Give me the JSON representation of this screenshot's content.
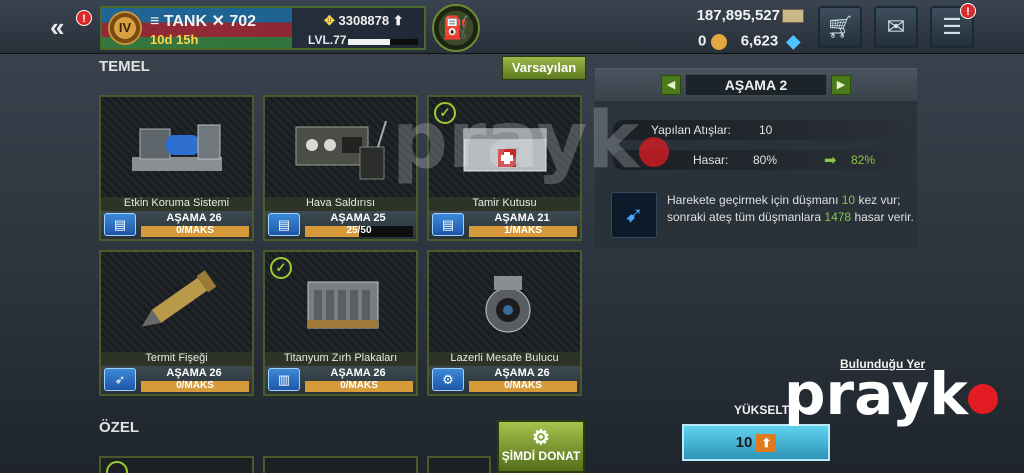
{
  "topbar": {
    "back_icon": "double-chevron-left",
    "back_badge": "!",
    "player": {
      "rank": "IV",
      "name": "TANK",
      "tank_number": "702",
      "timer": "10d 15h",
      "power": "3308878",
      "level": "LVL.77",
      "xp_progress": 0.6
    },
    "fuel_icon": "jerrycan-icon",
    "silver": "187,895,527",
    "gold": "0",
    "diamonds": "6,623",
    "shop_icon": "cart-icon",
    "mail_icon": "envelope-icon",
    "chat_icon": "chat-icon",
    "chat_badge": "!"
  },
  "sections": {
    "basic": "TEMEL",
    "special": "ÖZEL",
    "defaults_button": "Varsayılan",
    "equip_button": "ŞİMDİ DONAT"
  },
  "items": [
    {
      "name": "Etkin Koruma Sistemi",
      "level": "AŞAMA 26",
      "progress_text": "0/MAKS",
      "progress": 1.0,
      "equipped": false,
      "icon": "module-icon"
    },
    {
      "name": "Hava Saldırısı",
      "level": "AŞAMA 25",
      "progress_text": "25/50",
      "progress": 0.5,
      "equipped": false,
      "icon": "module-icon"
    },
    {
      "name": "Tamir Kutusu",
      "level": "AŞAMA 21",
      "progress_text": "1/MAKS",
      "progress": 1.0,
      "equipped": true,
      "icon": "module-icon"
    },
    {
      "name": "Termit Fişeği",
      "level": "AŞAMA 26",
      "progress_text": "0/MAKS",
      "progress": 1.0,
      "equipped": false,
      "icon": "shell-icon"
    },
    {
      "name": "Titanyum Zırh Plakaları",
      "level": "AŞAMA 26",
      "progress_text": "0/MAKS",
      "progress": 1.0,
      "equipped": true,
      "icon": "armor-icon"
    },
    {
      "name": "Lazerli Mesafe Bulucu",
      "level": "AŞAMA 26",
      "progress_text": "0/MAKS",
      "progress": 1.0,
      "equipped": false,
      "icon": "gears-icon"
    }
  ],
  "detail": {
    "stage": "AŞAMA 2",
    "attacks_label": "Yapılan Atışlar:",
    "attacks_value": "10",
    "damage_label": "Hasar:",
    "damage_current": "80%",
    "damage_next": "82%",
    "desc_part1": "Harekete geçirmek için düşmanı ",
    "desc_num1": "10",
    "desc_part2": " kez vur; sonraki ateş tüm düşmanlara ",
    "desc_num2": "1478",
    "desc_part3": " hasar verir.",
    "locate_link": "Bulunduğu Yer",
    "upgrade_label": "YÜKSELT",
    "upgrade_cost": "10"
  },
  "watermark": {
    "text": "prayk",
    "color": "#e31b23"
  }
}
